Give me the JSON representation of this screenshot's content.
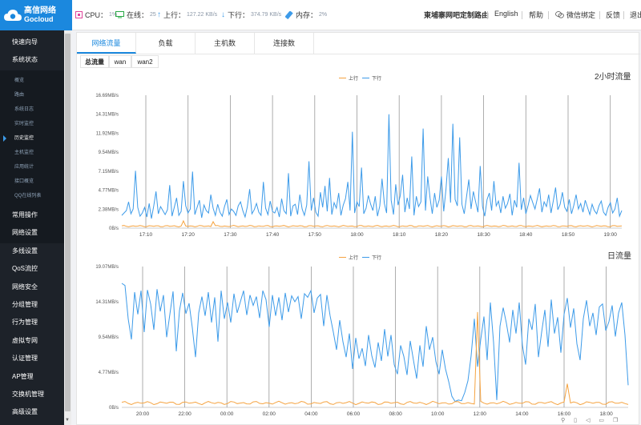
{
  "brand": {
    "name_cn": "高信网络",
    "name_en": "Gocloud",
    "color": "#1b88de"
  },
  "status": {
    "cpu_label": "CPU：",
    "cpu_value": "1%",
    "online_label": "在线：",
    "online_value": "25",
    "up_label": "上行：",
    "up_value": "127.22 KB/s",
    "down_label": "下行：",
    "down_value": "374.79 KB/s",
    "mem_label": "内存：",
    "mem_value": "2%"
  },
  "header": {
    "router_name": "東埔寨网吧定制路由",
    "language": "English",
    "help": "帮助",
    "wechat": "微信绑定",
    "feedback": "反馈",
    "logout": "退出"
  },
  "sidebar": {
    "top_items": [
      "快速向导",
      "系统状态"
    ],
    "sub_items": [
      "概览",
      "路由",
      "系统日志",
      "实时监控",
      "历史监控",
      "主机监控",
      "应用统计",
      "接口概览",
      "QQ在线列表"
    ],
    "active_sub": 4,
    "bottom_items": [
      "常用操作",
      "网络设置",
      "多线设置",
      "QoS流控",
      "网络安全",
      "分组管理",
      "行为管理",
      "虚拟专网",
      "认证管理",
      "AP管理",
      "交换机管理",
      "高级设置"
    ]
  },
  "tabs": [
    "网络流量",
    "负载",
    "主机数",
    "连接数"
  ],
  "active_tab": 0,
  "subtabs": [
    "总流量",
    "wan",
    "wan2"
  ],
  "active_subtab": 0,
  "colors": {
    "up": "#f5a340",
    "down": "#3d9be9",
    "sidebar": "#1d2229",
    "accent": "#1b88de"
  },
  "chart_data": [
    {
      "type": "line",
      "title": "2小时流量",
      "legend": [
        "上行",
        "下行"
      ],
      "legend_position": "top-center",
      "y_ticks": [
        "0B/s",
        "2.38MB/s",
        "4.77MB/s",
        "7.15MB/s",
        "9.54MB/s",
        "11.92MB/s",
        "14.31MB/s",
        "16.69MB/s"
      ],
      "ylim": [
        0,
        16.69
      ],
      "x_ticks": [
        "17:10",
        "17:20",
        "17:30",
        "17:40",
        "17:50",
        "18:00",
        "18:10",
        "18:20",
        "18:30",
        "18:40",
        "18:50",
        "19:00"
      ],
      "x_range": [
        "17:05",
        "19:05"
      ],
      "grid": "vertical",
      "series": [
        {
          "name": "上行",
          "approx_level_mb": 0.25,
          "peaks_mb": [
            [
              12.2,
              0.9
            ],
            [
              18.4,
              0.8
            ]
          ]
        },
        {
          "name": "下行",
          "approx_level_mb": 2.3,
          "samples_mb": [
            1.6,
            1.9,
            2.2,
            3.3,
            1.8,
            2.4,
            7.2,
            2.6,
            1.5,
            1.9,
            2.6,
            1.4,
            3.1,
            1.2,
            2.8,
            4.6,
            1.8,
            2.7,
            2.2,
            1.7,
            2.3,
            5.4,
            1.5,
            2.6,
            3.8,
            1.6,
            2.1,
            5.9,
            2.8,
            1.9,
            2.4,
            7.1,
            1.7,
            2.6,
            3.5,
            1.3,
            2.9,
            2.2,
            1.9,
            4.2,
            2.5,
            1.6,
            3.0,
            2.0,
            1.5,
            2.7,
            3.6,
            1.7,
            2.4,
            2.1,
            1.6,
            2.8,
            3.3,
            2.2,
            1.4,
            2.7,
            4.9,
            1.8,
            2.3,
            3.1,
            2.0,
            1.6,
            5.8,
            2.5,
            1.7,
            3.4,
            2.1,
            1.9,
            2.6,
            1.4,
            3.7,
            2.2,
            1.8,
            6.9,
            1.5,
            2.8,
            3.0,
            1.7,
            4.2,
            2.4,
            1.6,
            2.9,
            8.4,
            2.2,
            3.8,
            2.0,
            1.5,
            4.5,
            2.6,
            5.3,
            2.1,
            6.3,
            1.7,
            3.2,
            2.5,
            4.4,
            1.6,
            2.9,
            3.7,
            5.8,
            2.2,
            12.1,
            1.9,
            3.3,
            2.7,
            7.6,
            1.8,
            2.5,
            4.1,
            3.0,
            2.2,
            4.0,
            1.5,
            2.8,
            6.2,
            3.1,
            1.9,
            14.3,
            3.5,
            1.7,
            5.5,
            2.9,
            4.1,
            6.7,
            2.0,
            3.8,
            2.4,
            9.0,
            1.6,
            4.0,
            2.7,
            3.3,
            12.5,
            2.2,
            6.5,
            3.8,
            1.8,
            4.4,
            2.6,
            3.5,
            6.5,
            2.1,
            4.9,
            8.8,
            3.2,
            13.1,
            3.6,
            2.8,
            11.4,
            3.0,
            1.8,
            3.9,
            6.1,
            2.4,
            4.6,
            3.3,
            2.0,
            7.8,
            2.7,
            1.5,
            3.6,
            4.4,
            2.2,
            5.9,
            2.8,
            3.4,
            1.9,
            4.0,
            2.5,
            3.1,
            4.3,
            1.6,
            3.5,
            2.6,
            8.2,
            2.3,
            3.8,
            1.8,
            2.9,
            4.1,
            3.2,
            2.4,
            3.7,
            5.0,
            2.0,
            3.3,
            2.7,
            4.2,
            1.9,
            3.4,
            5.1,
            2.3,
            3.0,
            4.5,
            2.6,
            2.1,
            3.6,
            1.8,
            2.9,
            4.2,
            2.4,
            3.1,
            2.0,
            3.5,
            2.6,
            1.7,
            3.0,
            2.2,
            1.8,
            2.8,
            3.4,
            2.0,
            1.6,
            2.6,
            3.2,
            1.9,
            2.4,
            3.8,
            1.5,
            2.2
          ]
        }
      ]
    },
    {
      "type": "line",
      "title": "日流量",
      "legend": [
        "上行",
        "下行"
      ],
      "legend_position": "top-center",
      "y_ticks": [
        "0B/s",
        "4.77MB/s",
        "9.54MB/s",
        "14.31MB/s",
        "19.07MB/s"
      ],
      "ylim": [
        0,
        19.07
      ],
      "x_ticks": [
        "20:00",
        "22:00",
        "00:00",
        "02:00",
        "04:00",
        "06:00",
        "08:00",
        "10:00",
        "12:00",
        "14:00",
        "16:00",
        "18:00"
      ],
      "x_range": [
        "19:00",
        "19:00"
      ],
      "grid": "vertical",
      "series": [
        {
          "name": "上行",
          "approx_level_mb": 0.6,
          "peaks_mb": [
            [
              11.8,
              12.9
            ],
            [
              16.1,
              3.2
            ]
          ]
        },
        {
          "name": "下行",
          "samples_mb": [
            16.8,
            16.5,
            12.0,
            9.2,
            15.6,
            12.6,
            15.8,
            10.2,
            15.9,
            14.0,
            10.5,
            16.0,
            13.0,
            15.2,
            9.5,
            12.6,
            15.7,
            7.6,
            13.1,
            15.5,
            12.7,
            14.1,
            10.8,
            6.8,
            12.8,
            15.0,
            12.4,
            15.6,
            11.5,
            14.9,
            8.9,
            15.8,
            12.0,
            14.2,
            11.5,
            15.4,
            12.8,
            14.3,
            15.8,
            12.5,
            15.2,
            13.8,
            15.0,
            12.1,
            15.8,
            14.6,
            10.9,
            15.2,
            12.4,
            14.9,
            11.8,
            15.5,
            12.9,
            15.1,
            14.3,
            15.0,
            12.0,
            15.4,
            14.9,
            15.8,
            12.8,
            14.8,
            15.3,
            11.0,
            15.2,
            12.4,
            10.2,
            7.8,
            11.8,
            8.9,
            6.8,
            10.0,
            5.2,
            9.4,
            6.6,
            8.0,
            5.6,
            9.8,
            7.0,
            5.4,
            8.8,
            6.3,
            10.6,
            6.9,
            9.8,
            5.8,
            4.5,
            8.4,
            6.9,
            4.4,
            9.0,
            6.4,
            3.9,
            8.4,
            5.5,
            11.0,
            7.8,
            9.5,
            6.2,
            4.5,
            7.8,
            5.2,
            3.5,
            1.5,
            0.8,
            1.0,
            0.9,
            2.0,
            3.6,
            7.0,
            12.0,
            5.5,
            9.2,
            12.3,
            6.4,
            14.2,
            8.8,
            1.0,
            11.0,
            13.5,
            11.4,
            8.8,
            13.2,
            10.0,
            14.2,
            8.4,
            5.8,
            12.0,
            10.5,
            14.0,
            6.8,
            10.2,
            13.2,
            8.2,
            14.6,
            10.0,
            12.2,
            7.4,
            12.6,
            14.8,
            10.8,
            13.4,
            8.6,
            6.4,
            12.0,
            14.5,
            11.0,
            12.8,
            9.8,
            13.6,
            14.0,
            10.4,
            11.6,
            13.8,
            9.6,
            12.8,
            14.2,
            9.8,
            3.0
          ]
        }
      ]
    }
  ]
}
